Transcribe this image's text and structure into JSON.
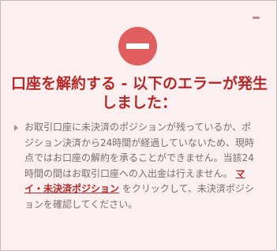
{
  "dialog": {
    "title": "口座を解約する - 以下のエラーが発生しました：",
    "message": {
      "part1": "お取引口座に未決済のポジションが残っているか、ポジション決済から24時間が経過していないため、現時点ではお口座の解約を承ることができません。当該24時間の間はお取引口座への入出金は行えません。",
      "link_text": "マイ・未決済ポジション",
      "part2": "をクリックして、未決済ポジションを確認してください。"
    }
  },
  "icons": {
    "error": "error-minus-circle-icon",
    "bullet": "caret-right-icon",
    "minimize": "minimize-icon"
  },
  "colors": {
    "background": "#fbefef",
    "title": "#b62828",
    "error_icon": "#e05e5e",
    "text": "#7c6c6c",
    "link": "#b62828"
  }
}
